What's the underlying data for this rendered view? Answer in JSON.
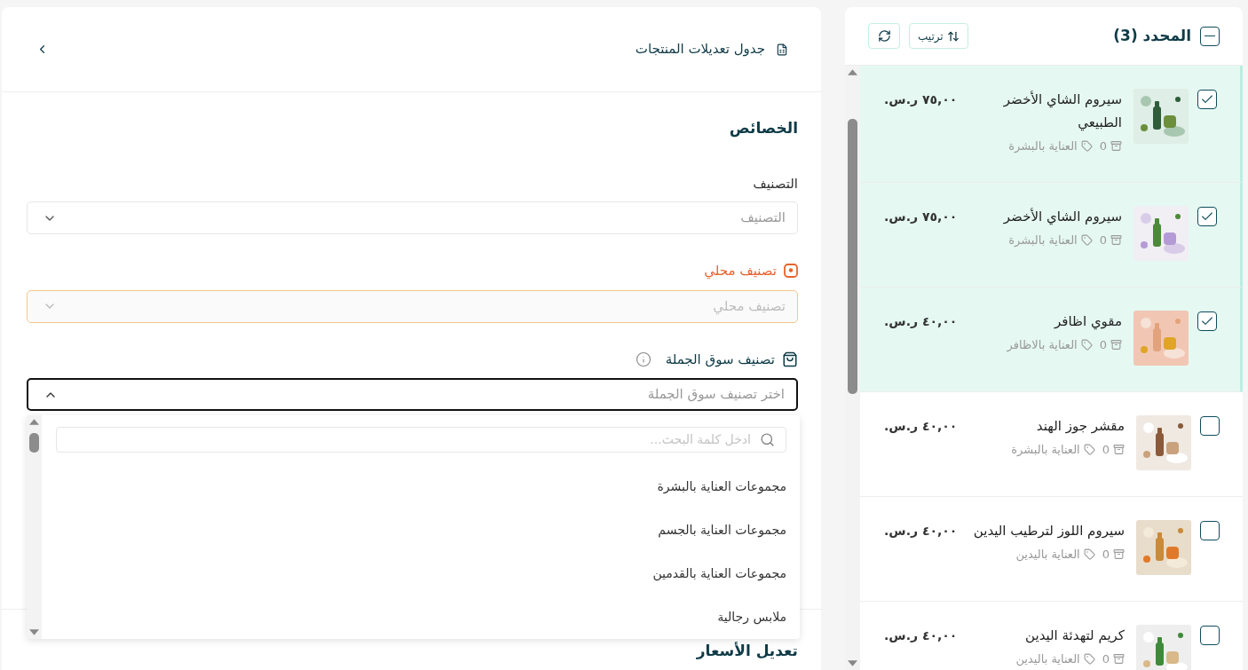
{
  "editor": {
    "title": "جدول تعديلات المنتجات",
    "section_title": "الخصائص",
    "category": {
      "label": "التصنيف",
      "placeholder": "التصنيف"
    },
    "local_category": {
      "label": "تصنيف محلي",
      "placeholder": "تصنيف محلي",
      "disabled": true
    },
    "wholesale_category": {
      "label": "تصنيف سوق الجملة",
      "placeholder": "اختر تصنيف سوق الجملة",
      "expanded": true,
      "search_placeholder": "ادخل كلمة البحث...",
      "options": [
        {
          "label": "مجموعات العناية بالبشرة",
          "selected": false
        },
        {
          "label": "مجموعات العناية بالجسم",
          "selected": false
        },
        {
          "label": "مجموعات العناية بالقدمين",
          "selected": false
        },
        {
          "label": "ملابس رجالية",
          "selected": false
        }
      ]
    },
    "next_section_title": "تعديل الأسعار"
  },
  "selection": {
    "title": "المحدد (3)",
    "indeterminate": true,
    "sort_label": "ترتيب",
    "products": [
      {
        "name": "سيروم الشاي الأخضر الطبيعي",
        "count": "0",
        "category": "العناية بالبشرة",
        "price": "٧٥,٠٠ ر.س.",
        "checked": true
      },
      {
        "name": "سيروم الشاي الأخضر",
        "count": "0",
        "category": "العناية بالبشرة",
        "price": "٧٥,٠٠ ر.س.",
        "checked": true
      },
      {
        "name": "مقوي اظافر",
        "count": "0",
        "category": "العناية بالاظافر",
        "price": "٤٠,٠٠ ر.س.",
        "checked": true
      },
      {
        "name": "مقشر جوز الهند",
        "count": "0",
        "category": "العناية بالبشرة",
        "price": "٤٠,٠٠ ر.س.",
        "checked": false
      },
      {
        "name": "سيروم اللوز لترطيب اليدين",
        "count": "0",
        "category": "العناية باليدين",
        "price": "٤٠,٠٠ ر.س.",
        "checked": false
      },
      {
        "name": "كريم لتهدئة اليدين",
        "count": "0",
        "category": "العناية باليدين",
        "price": "٤٠,٠٠ ر.س.",
        "checked": false
      }
    ]
  }
}
